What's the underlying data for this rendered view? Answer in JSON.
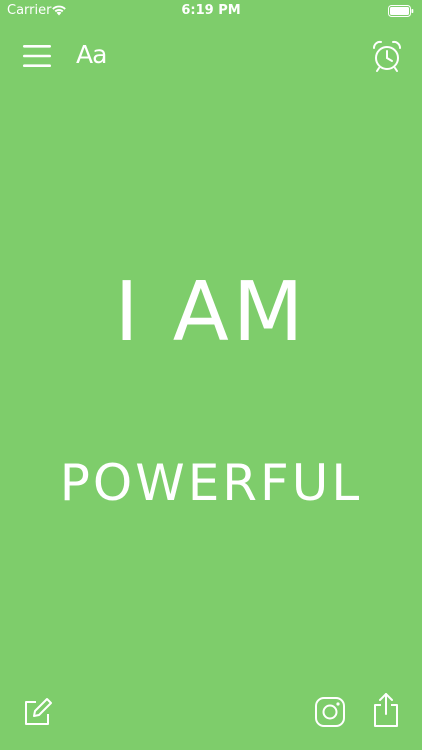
{
  "status_bar": {
    "carrier": "Carrier",
    "time": "6:19 PM",
    "icons": [
      "wifi-icon",
      "battery-icon"
    ]
  },
  "toolbar": {
    "menu_icon": "hamburger-menu-icon",
    "font_label": "Aa",
    "alarm_icon": "alarm-clock-icon"
  },
  "affirmation": {
    "line1": "I AM",
    "line2": "POWERFUL"
  },
  "bottom_bar": {
    "edit_icon": "edit-icon",
    "instagram_icon": "instagram-icon",
    "share_icon": "share-icon"
  },
  "colors": {
    "background": "#7ecd6b",
    "foreground": "#ffffff"
  }
}
